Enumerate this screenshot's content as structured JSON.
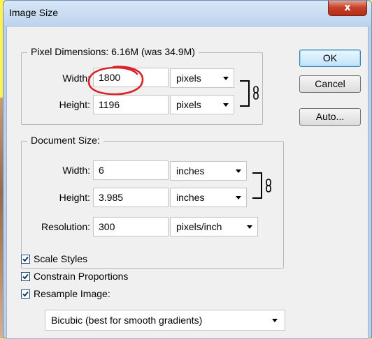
{
  "window": {
    "title": "Image Size",
    "close_label": "x"
  },
  "pixel_dimensions": {
    "legend": "Pixel Dimensions:  6.16M (was 34.9M)",
    "width_label": "Width:",
    "width_value": "1800",
    "width_unit": "pixels",
    "height_label": "Height:",
    "height_value": "1196",
    "height_unit": "pixels"
  },
  "document_size": {
    "legend": "Document Size:",
    "width_label": "Width:",
    "width_value": "6",
    "width_unit": "inches",
    "height_label": "Height:",
    "height_value": "3.985",
    "height_unit": "inches",
    "resolution_label": "Resolution:",
    "resolution_value": "300",
    "resolution_unit": "pixels/inch"
  },
  "buttons": {
    "ok": "OK",
    "cancel": "Cancel",
    "auto": "Auto..."
  },
  "options": {
    "scale_styles": {
      "label": "Scale Styles",
      "checked": true
    },
    "constrain_proportions": {
      "label": "Constrain Proportions",
      "checked": true
    },
    "resample_image": {
      "label": "Resample Image:",
      "checked": true
    },
    "resample_method": "Bicubic (best for smooth gradients)"
  },
  "colors": {
    "annotation": "#d8232a",
    "background": "#fff24a"
  }
}
